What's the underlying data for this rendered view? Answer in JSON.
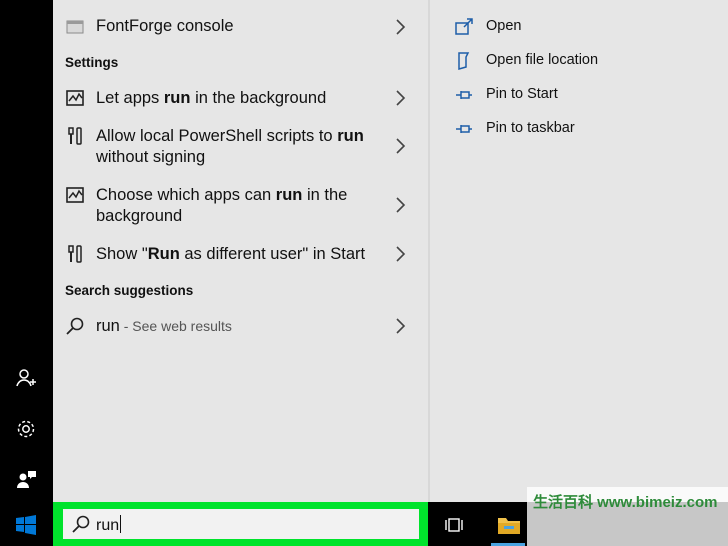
{
  "results": {
    "top_app": {
      "label": "FontForge console"
    },
    "settings": {
      "header": "Settings",
      "items": [
        {
          "pre": "Let apps ",
          "bold": "run",
          "post": " in the background",
          "icon": "activity-chart-icon"
        },
        {
          "pre": "Allow local PowerShell scripts to ",
          "bold": "run",
          "post": " without signing",
          "icon": "tools-icon"
        },
        {
          "pre": "Choose which apps can ",
          "bold": "run",
          "post": " in the background",
          "icon": "activity-chart-icon"
        },
        {
          "pre": "Show \"",
          "bold": "Run",
          "post": " as different user\" in Start",
          "icon": "tools-icon"
        }
      ]
    },
    "suggestions": {
      "header": "Search suggestions",
      "item": {
        "query": "run",
        "suffix": " - See web results"
      }
    }
  },
  "actions": [
    {
      "label": "Open",
      "icon": "open-icon"
    },
    {
      "label": "Open file location",
      "icon": "file-location-icon"
    },
    {
      "label": "Pin to Start",
      "icon": "pin-icon"
    },
    {
      "label": "Pin to taskbar",
      "icon": "pin-icon"
    }
  ],
  "search": {
    "value": "run"
  },
  "watermark": {
    "text": "生活百科 www.bimeiz.com"
  },
  "colors": {
    "search_highlight": "#00e32c",
    "accent_blue": "#1e5ea8",
    "start_blue": "#0078d7"
  }
}
